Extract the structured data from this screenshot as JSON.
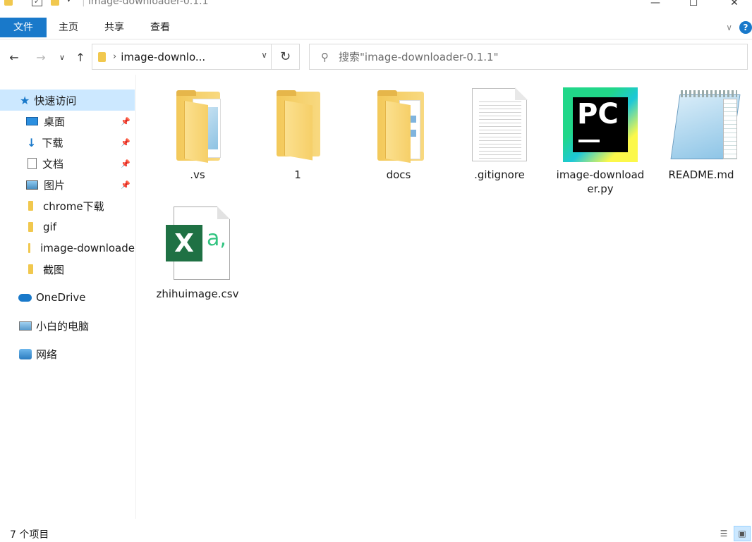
{
  "window": {
    "title": "image-downloader-0.1.1",
    "minimize": "—",
    "maximize": "☐",
    "close": "✕"
  },
  "ribbon": {
    "file": "文件",
    "home": "主页",
    "share": "共享",
    "view": "查看",
    "help": "?"
  },
  "address": {
    "crumb": "image-downlo..."
  },
  "search": {
    "placeholder": "搜索\"image-downloader-0.1.1\""
  },
  "nav": {
    "quick_access": "快速访问",
    "items": [
      {
        "label": "桌面",
        "pinned": true
      },
      {
        "label": "下载",
        "pinned": true
      },
      {
        "label": "文档",
        "pinned": true
      },
      {
        "label": "图片",
        "pinned": true
      },
      {
        "label": "chrome下载",
        "pinned": false
      },
      {
        "label": "gif",
        "pinned": false
      },
      {
        "label": "image-downloade",
        "pinned": false
      },
      {
        "label": "截图",
        "pinned": false
      }
    ],
    "onedrive": "OneDrive",
    "this_pc": "小白的电脑",
    "network": "网络"
  },
  "files": [
    {
      "name": ".vs",
      "type": "folder-doc"
    },
    {
      "name": "1",
      "type": "folder"
    },
    {
      "name": "docs",
      "type": "folder-images"
    },
    {
      "name": ".gitignore",
      "type": "text"
    },
    {
      "name": "image-downloader.py",
      "type": "pycharm"
    },
    {
      "name": "README.md",
      "type": "notepad"
    },
    {
      "name": "zhihuimage.csv",
      "type": "excel-csv"
    }
  ],
  "excel_icon": {
    "letter": "X",
    "suffix": "a,"
  },
  "pycharm_icon": {
    "letters": "PC"
  },
  "status": {
    "count": "7 个项目"
  },
  "colors": {
    "accent": "#1979ca",
    "selection": "#cce8ff"
  }
}
